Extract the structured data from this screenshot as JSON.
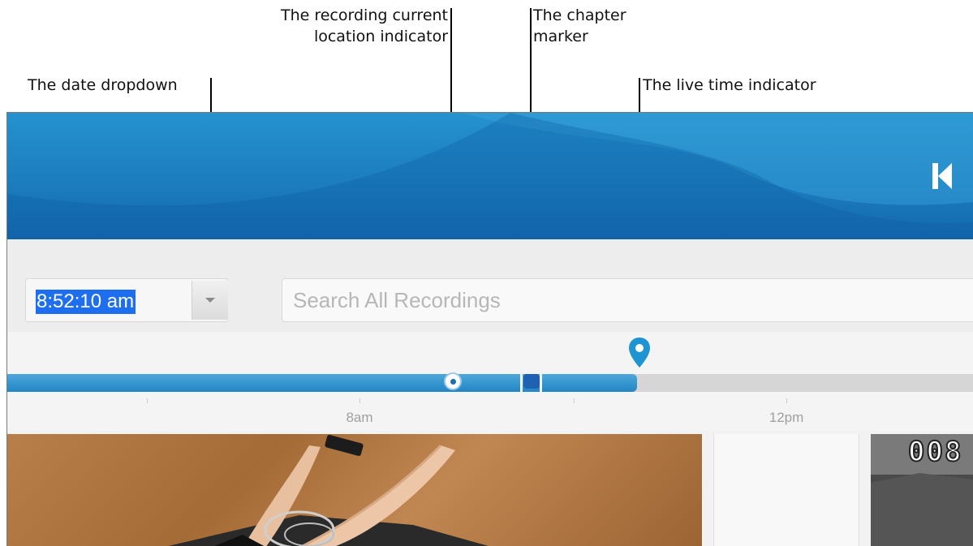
{
  "annotations": {
    "recording_location": "The recording current\nlocation indicator",
    "chapter_marker": "The chapter\nmarker",
    "date_dropdown": "The date dropdown",
    "live_time": "The live time indicator"
  },
  "toolbar": {
    "date_value": "8:52:10 am",
    "search_placeholder": "Search All Recordings"
  },
  "timeline": {
    "ticks": [
      "8am",
      "12pm"
    ],
    "played_fraction": 0.65
  },
  "video_thumb": {
    "counter": "008"
  },
  "colors": {
    "banner": "#1b7bbd",
    "accent": "#2185c5",
    "selection": "#1e6ef0",
    "chapter": "#1f62b3"
  },
  "icons": {
    "back": "skip-back-icon",
    "dropdown": "chevron-down-icon",
    "live": "map-pin-icon"
  }
}
